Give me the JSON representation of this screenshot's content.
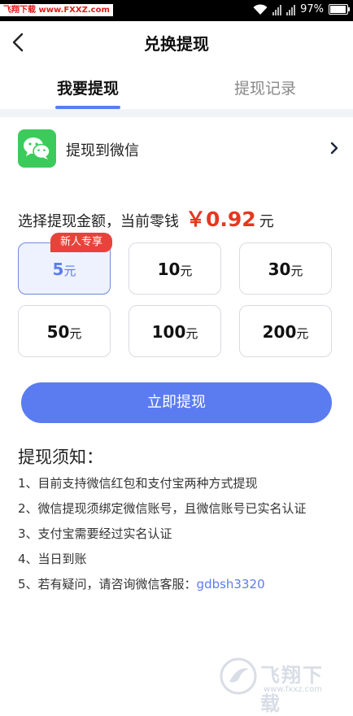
{
  "status_bar": {
    "watermark": "飞翔下载 www.FXXZ.com",
    "battery": "97%",
    "battery_level": 0.97
  },
  "nav": {
    "title": "兑换提现"
  },
  "tabs": [
    {
      "label": "我要提现",
      "active": true
    },
    {
      "label": "提现记录",
      "active": false
    }
  ],
  "wechat": {
    "label": "提现到微信",
    "icon": "wechat-icon"
  },
  "amount": {
    "prompt": "选择提现金额，当前零钱",
    "value": "￥0.92",
    "unit": "元"
  },
  "options": [
    {
      "num": "5",
      "unit": "元",
      "selected": true
    },
    {
      "num": "10",
      "unit": "元"
    },
    {
      "num": "30",
      "unit": "元"
    },
    {
      "num": "50",
      "unit": "元"
    },
    {
      "num": "100",
      "unit": "元"
    },
    {
      "num": "200",
      "unit": "元"
    }
  ],
  "badge": "新人专享",
  "submit_label": "立即提现",
  "notice": {
    "title": "提现须知：",
    "items": [
      "1、目前支持微信红包和支付宝两种方式提现",
      "2、微信提现须绑定微信账号，且微信账号已实名认证",
      "3、支付宝需要经过实名认证",
      "4、当日到账",
      "5、若有疑问，请咨询微信客服："
    ],
    "contact": "gdbsh3320"
  },
  "brand": {
    "name": "飞翔下载",
    "url": "www.fxxz.com"
  },
  "colors": {
    "accent": "#5b7cf0",
    "money": "#e8361f",
    "wechat": "#3ccb5a",
    "badge": "#e8433a"
  }
}
